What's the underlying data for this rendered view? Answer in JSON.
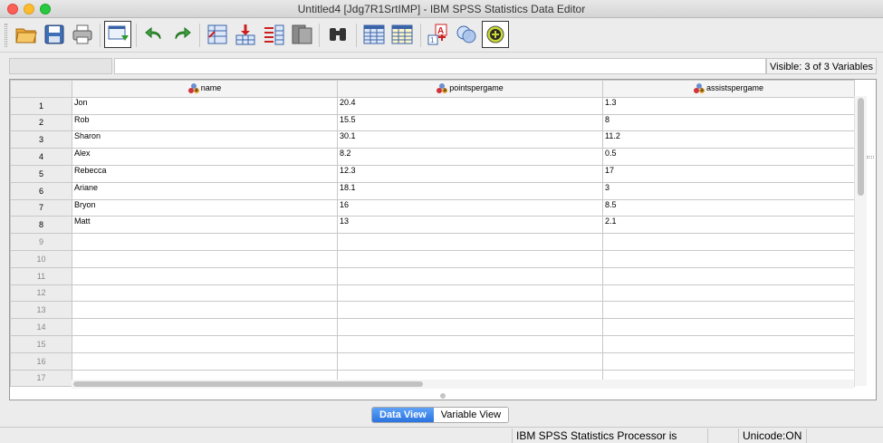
{
  "window": {
    "title": "Untitled4 [Jdg7R1SrtIMP] - IBM SPSS Statistics Data Editor"
  },
  "toolbar": {
    "buttons": [
      "open-data-icon",
      "save-icon",
      "print-icon",
      "recall-dialog-icon",
      "undo-icon",
      "redo-icon",
      "go-to-case-icon",
      "go-to-variable-icon",
      "variables-icon",
      "run-descriptives-icon",
      "find-icon",
      "insert-cases-icon",
      "insert-variable-icon",
      "value-labels-icon",
      "use-variable-sets-icon",
      "spelling-icon"
    ]
  },
  "editor": {
    "cell_name": "",
    "cell_value": "",
    "visible_label": "Visible: 3 of 3 Variables"
  },
  "grid": {
    "columns": [
      "name",
      "pointspergame",
      "assistspergame"
    ],
    "rows": [
      {
        "num": "1",
        "cells": [
          "Jon",
          "20.4",
          "1.3"
        ]
      },
      {
        "num": "2",
        "cells": [
          "Rob",
          "15.5",
          "8"
        ]
      },
      {
        "num": "3",
        "cells": [
          "Sharon",
          "30.1",
          "11.2"
        ]
      },
      {
        "num": "4",
        "cells": [
          "Alex",
          "8.2",
          "0.5"
        ]
      },
      {
        "num": "5",
        "cells": [
          "Rebecca",
          "12.3",
          "17"
        ]
      },
      {
        "num": "6",
        "cells": [
          "Ariane",
          "18.1",
          "3"
        ]
      },
      {
        "num": "7",
        "cells": [
          "Bryon",
          "16",
          "8.5"
        ]
      },
      {
        "num": "8",
        "cells": [
          "Matt",
          "13",
          "2.1"
        ]
      },
      {
        "num": "9",
        "cells": [
          "",
          "",
          ""
        ]
      },
      {
        "num": "10",
        "cells": [
          "",
          "",
          ""
        ]
      },
      {
        "num": "11",
        "cells": [
          "",
          "",
          ""
        ]
      },
      {
        "num": "12",
        "cells": [
          "",
          "",
          ""
        ]
      },
      {
        "num": "13",
        "cells": [
          "",
          "",
          ""
        ]
      },
      {
        "num": "14",
        "cells": [
          "",
          "",
          ""
        ]
      },
      {
        "num": "15",
        "cells": [
          "",
          "",
          ""
        ]
      },
      {
        "num": "16",
        "cells": [
          "",
          "",
          ""
        ]
      },
      {
        "num": "17",
        "cells": [
          "",
          "",
          ""
        ]
      }
    ]
  },
  "tabs": {
    "data_view": "Data View",
    "variable_view": "Variable View",
    "active": "Data View"
  },
  "status": {
    "processor": "IBM SPSS Statistics Processor is ready",
    "unicode": "Unicode:ON"
  },
  "colors": {
    "active_tab": "#2a72e0",
    "grid_line": "#c8c8c8",
    "header_bg": "#ececec"
  }
}
